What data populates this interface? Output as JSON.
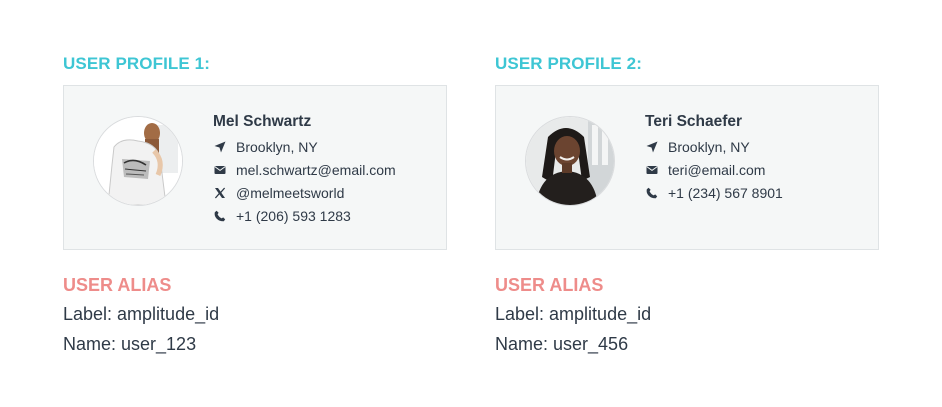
{
  "profiles": [
    {
      "heading": "USER PROFILE 1:",
      "name": "Mel Schwartz",
      "location": "Brooklyn, NY",
      "email": "mel.schwartz@email.com",
      "handle": "@melmeetsworld",
      "phone": "+1 (206) 593 1283",
      "alias_title": "USER ALIAS",
      "alias_label": "Label: amplitude_id",
      "alias_name": "Name: user_123"
    },
    {
      "heading": "USER PROFILE 2:",
      "name": "Teri Schaefer",
      "location": "Brooklyn, NY",
      "email": "teri@email.com",
      "phone": "+1 (234) 567 8901",
      "alias_title": "USER ALIAS",
      "alias_label": "Label: amplitude_id",
      "alias_name": "Name: user_456"
    }
  ],
  "icons": {
    "location": "location-arrow-icon",
    "email": "envelope-icon",
    "social": "x-logo-icon",
    "phone": "phone-icon"
  },
  "colors": {
    "heading": "#3ec6d4",
    "alias_title": "#ee8c8a",
    "text": "#2f3a47",
    "card_bg": "#f5f7f7",
    "card_border": "#dfe3e5"
  }
}
